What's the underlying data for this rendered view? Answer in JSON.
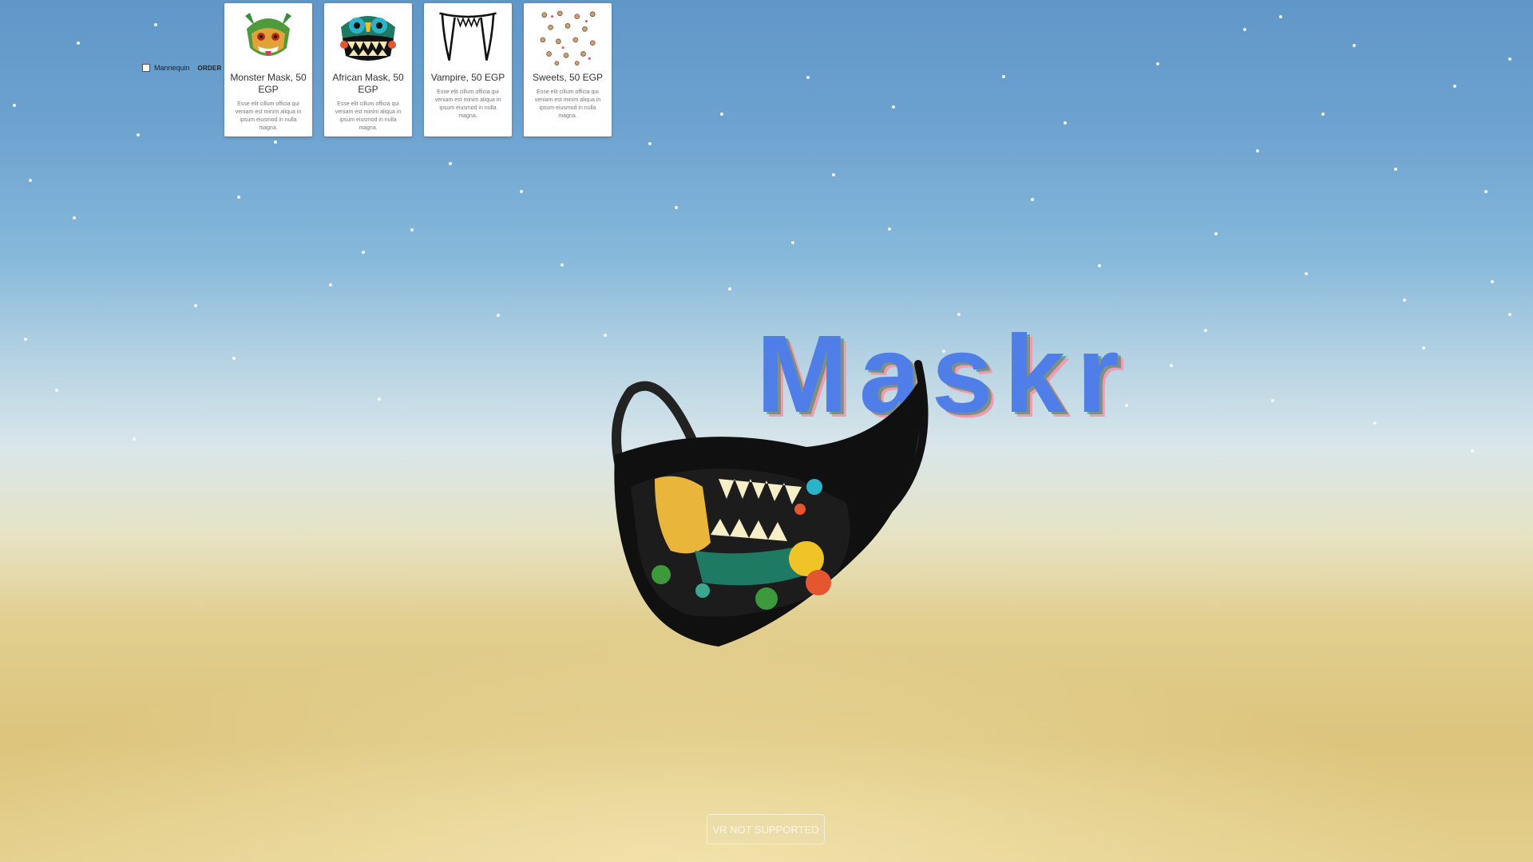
{
  "app": {
    "title": "Maskr"
  },
  "controls": {
    "mannequin_label": "Mannequin",
    "order_label": "ORDER"
  },
  "products": [
    {
      "title": "Monster Mask, 50 EGP",
      "description": "Esse elit cillum officia qui veniam est minim aliqua in ipsum eiusmod in nulla magna.",
      "icon": "monster-mask-icon"
    },
    {
      "title": "African Mask, 50 EGP",
      "description": "Esse elit cillum officia qui veniam est minim aliqua in ipsum eiusmod in nulla magna.",
      "icon": "african-mask-icon"
    },
    {
      "title": "Vampire, 50 EGP",
      "description": "Esse elit cillum officia qui veniam est minim aliqua in ipsum eiusmod in nulla magna.",
      "icon": "vampire-fangs-icon"
    },
    {
      "title": "Sweets, 50 EGP",
      "description": "Esse elit cillum officia qui veniam est minim aliqua in ipsum eiusmod in nulla magna.",
      "icon": "sweets-pattern-icon"
    }
  ],
  "logo": {
    "text": "Maskr",
    "colors": {
      "face": "#4f7ee8",
      "accent_pink": "#f29bb0",
      "accent_green": "#1f8a5a"
    }
  },
  "vr_button": {
    "label": "VR NOT SUPPORTED"
  }
}
